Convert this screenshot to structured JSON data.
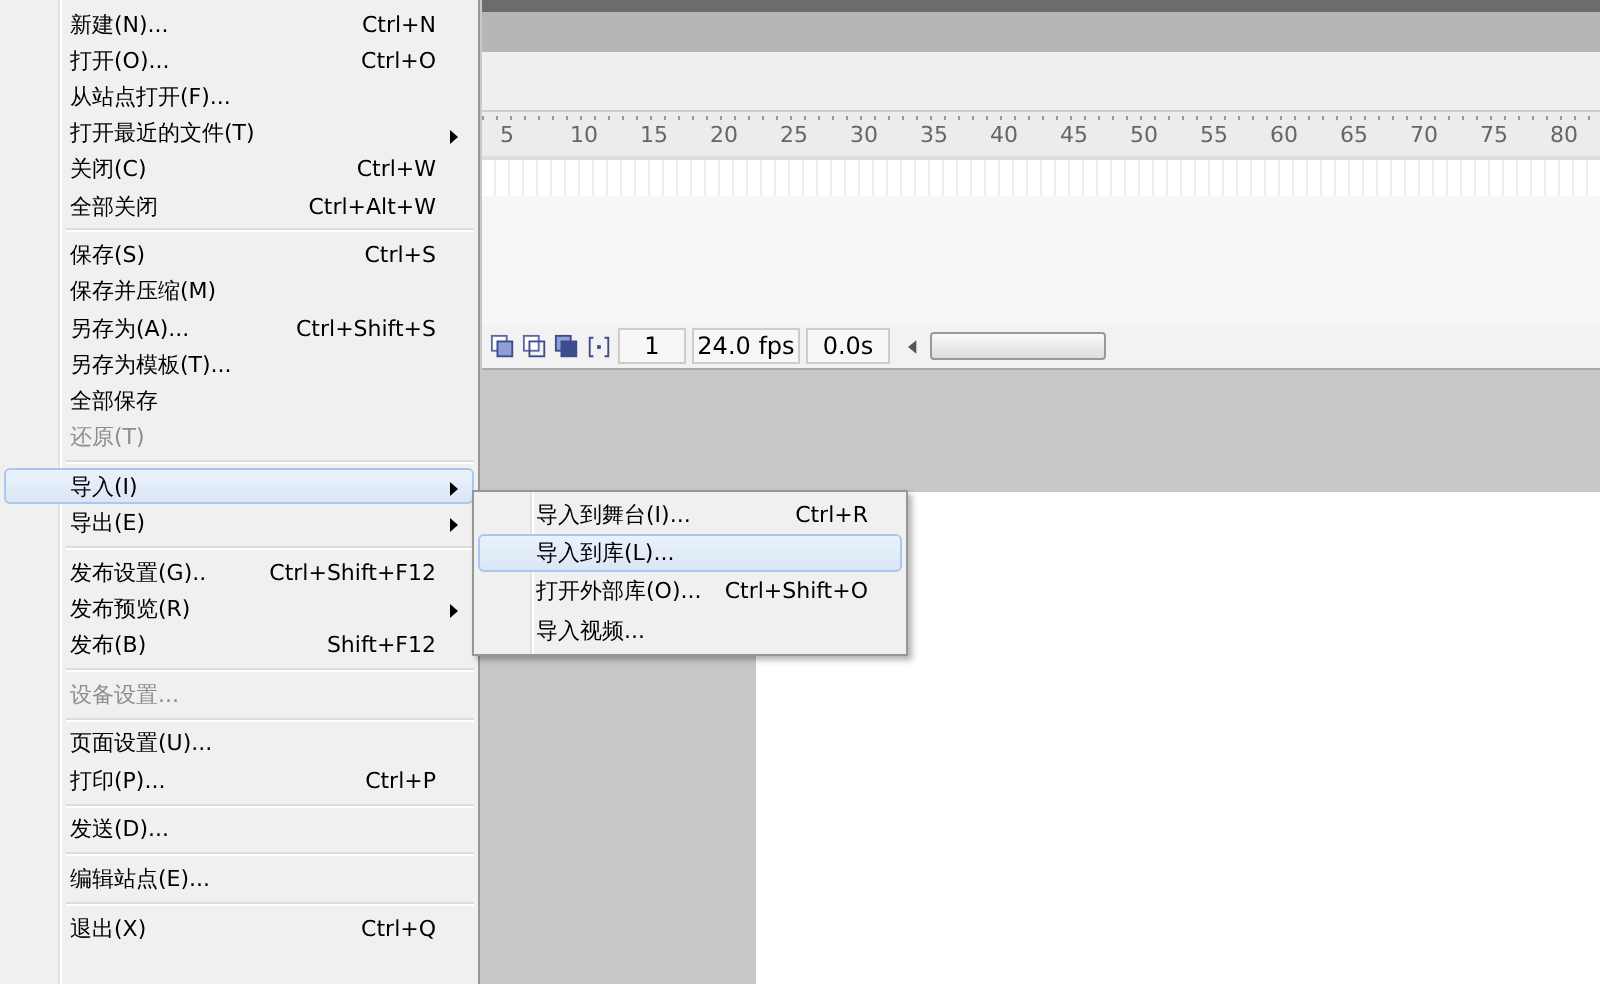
{
  "menu": {
    "items": [
      {
        "kind": "item",
        "label": "新建(N)...",
        "shortcut": "Ctrl+N"
      },
      {
        "kind": "item",
        "label": "打开(O)...",
        "shortcut": "Ctrl+O"
      },
      {
        "kind": "item",
        "label": "从站点打开(F)..."
      },
      {
        "kind": "submenu",
        "label": "打开最近的文件(T)"
      },
      {
        "kind": "item",
        "label": "关闭(C)",
        "shortcut": "Ctrl+W"
      },
      {
        "kind": "item",
        "label": "全部关闭",
        "shortcut": "Ctrl+Alt+W"
      },
      {
        "kind": "separator"
      },
      {
        "kind": "item",
        "label": "保存(S)",
        "shortcut": "Ctrl+S"
      },
      {
        "kind": "item",
        "label": "保存并压缩(M)"
      },
      {
        "kind": "item",
        "label": "另存为(A)...",
        "shortcut": "Ctrl+Shift+S"
      },
      {
        "kind": "item",
        "label": "另存为模板(T)..."
      },
      {
        "kind": "item",
        "label": "全部保存"
      },
      {
        "kind": "item",
        "label": "还原(T)",
        "disabled": true
      },
      {
        "kind": "separator"
      },
      {
        "kind": "submenu",
        "label": "导入(I)",
        "selected": true
      },
      {
        "kind": "submenu",
        "label": "导出(E)"
      },
      {
        "kind": "separator"
      },
      {
        "kind": "item",
        "label": "发布设置(G)..",
        "shortcut": "Ctrl+Shift+F12"
      },
      {
        "kind": "submenu",
        "label": "发布预览(R)"
      },
      {
        "kind": "item",
        "label": "发布(B)",
        "shortcut": "Shift+F12"
      },
      {
        "kind": "separator"
      },
      {
        "kind": "item",
        "label": "设备设置...",
        "disabled": true
      },
      {
        "kind": "separator"
      },
      {
        "kind": "item",
        "label": "页面设置(U)..."
      },
      {
        "kind": "item",
        "label": "打印(P)...",
        "shortcut": "Ctrl+P"
      },
      {
        "kind": "separator"
      },
      {
        "kind": "item",
        "label": "发送(D)..."
      },
      {
        "kind": "separator"
      },
      {
        "kind": "item",
        "label": "编辑站点(E)..."
      },
      {
        "kind": "separator"
      },
      {
        "kind": "item",
        "label": "退出(X)",
        "shortcut": "Ctrl+Q"
      }
    ]
  },
  "submenu": {
    "items": [
      {
        "label": "导入到舞台(I)...",
        "shortcut": "Ctrl+R",
        "selected": false
      },
      {
        "label": "导入到库(L)...",
        "selected": true
      },
      {
        "label": "打开外部库(O)...",
        "shortcut": "Ctrl+Shift+O",
        "selected": false
      },
      {
        "label": "导入视频...",
        "selected": false
      }
    ]
  },
  "timeline": {
    "ruler": [
      "5",
      "10",
      "15",
      "20",
      "25",
      "30",
      "35",
      "40",
      "45",
      "50",
      "55",
      "60",
      "65",
      "70",
      "75",
      "80"
    ],
    "frame": "1",
    "fps": "24.0 fps",
    "time": "0.0s"
  }
}
